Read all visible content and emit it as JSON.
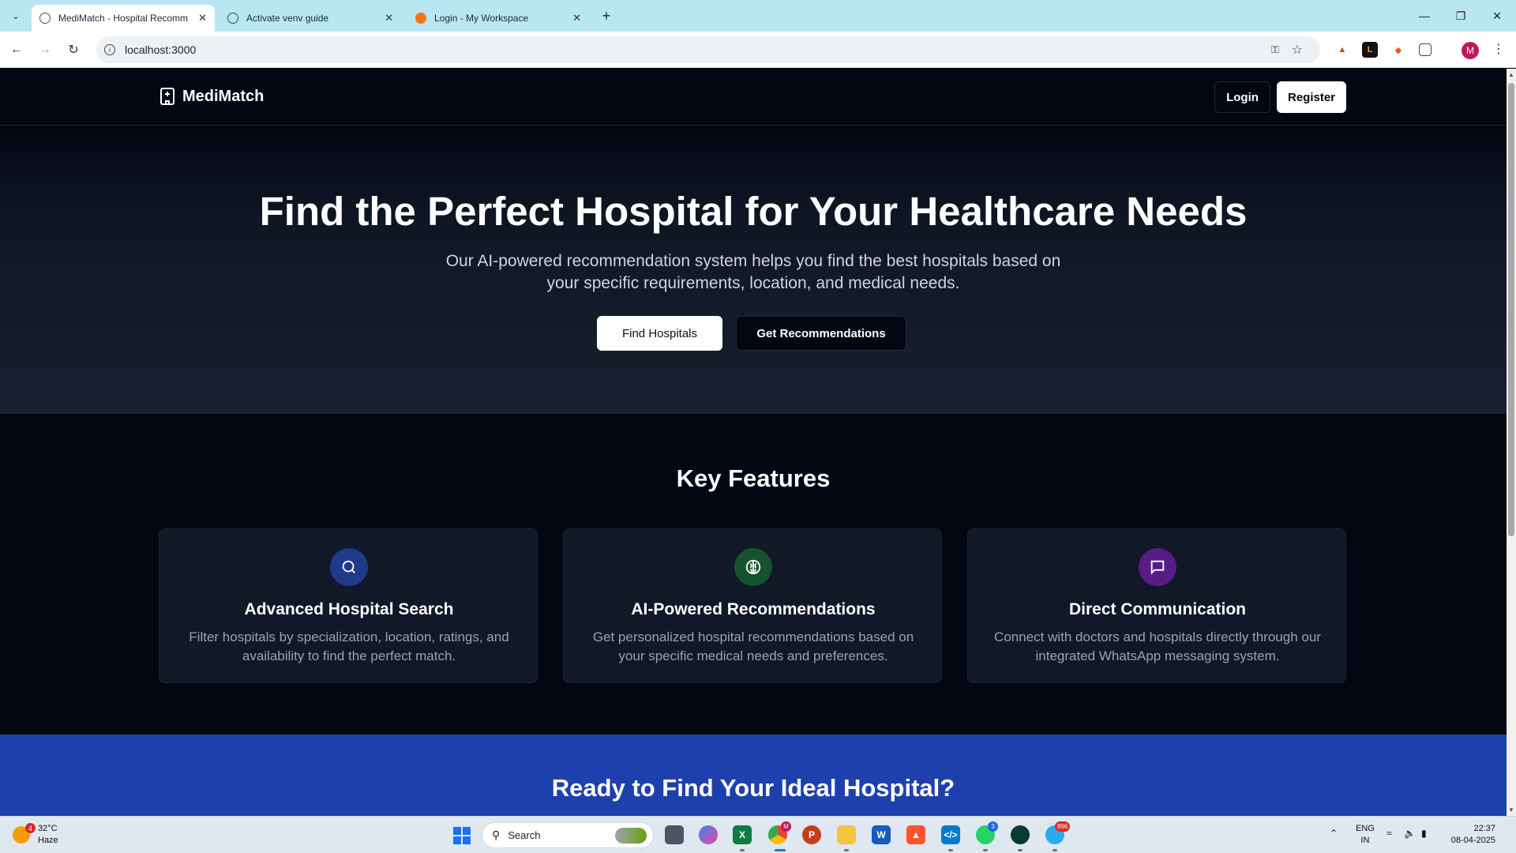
{
  "browser": {
    "tabs": [
      {
        "title": "MediMatch - Hospital Recomm",
        "active": true
      },
      {
        "title": "Activate venv guide",
        "active": false
      },
      {
        "title": "Login - My Workspace",
        "active": false
      }
    ],
    "url": "localhost:3000",
    "profile_initial": "M",
    "colors": {
      "tabbar": "#b8e6f3",
      "profile": "#be185d"
    }
  },
  "nav": {
    "brand": "MediMatch",
    "login": "Login",
    "register": "Register"
  },
  "hero": {
    "title": "Find the Perfect Hospital for Your Healthcare Needs",
    "subtitle": "Our AI-powered recommendation system helps you find the best hospitals based on your specific requirements, location, and medical needs.",
    "primary_button": "Find Hospitals",
    "secondary_button": "Get Recommendations"
  },
  "features": {
    "heading": "Key Features",
    "cards": [
      {
        "icon": "search-icon",
        "title": "Advanced Hospital Search",
        "text": "Filter hospitals by specialization, location, ratings, and availability to find the perfect match.",
        "color": "#1e3a8a"
      },
      {
        "icon": "brain-icon",
        "title": "AI-Powered Recommendations",
        "text": "Get personalized hospital recommendations based on your specific medical needs and preferences.",
        "color": "#14532d"
      },
      {
        "icon": "message-icon",
        "title": "Direct Communication",
        "text": "Connect with doctors and hospitals directly through our integrated WhatsApp messaging system.",
        "color": "#581c87"
      }
    ]
  },
  "cta": {
    "heading": "Ready to Find Your Ideal Hospital?",
    "color": "#1e40af"
  },
  "taskbar": {
    "weather_temp": "32°C",
    "weather_desc": "Haze",
    "weather_badge": "4",
    "search_label": "Search",
    "whatsapp_badge": "3",
    "telegram_badge": "896",
    "chrome_badge": "M",
    "lang_line1": "ENG",
    "lang_line2": "IN",
    "time": "22:37",
    "date": "08-04-2025"
  }
}
